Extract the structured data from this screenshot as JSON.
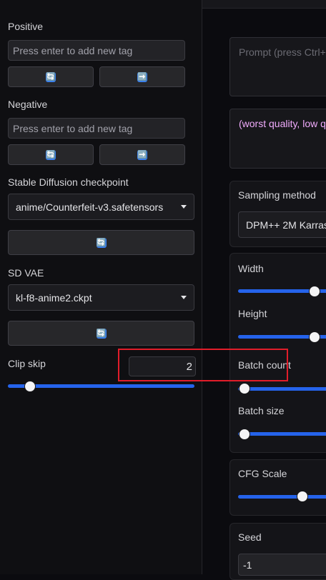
{
  "left": {
    "positive": {
      "label": "Positive",
      "placeholder": "Press enter to add new tag",
      "refresh_icon": "🔄",
      "send_icon": "➡️"
    },
    "negative": {
      "label": "Negative",
      "placeholder": "Press enter to add new tag",
      "refresh_icon": "🔄",
      "send_icon": "➡️"
    },
    "checkpoint": {
      "label": "Stable Diffusion checkpoint",
      "value": "anime/Counterfeit-v3.safetensors",
      "refresh_icon": "🔄"
    },
    "vae": {
      "label": "SD VAE",
      "value": "kl-f8-anime2.ckpt",
      "refresh_icon": "🔄"
    },
    "clip_skip": {
      "label": "Clip skip",
      "value": "2",
      "slider_fraction": 0.12
    }
  },
  "right": {
    "prompt_placeholder": "Prompt (press Ctrl+",
    "negative_prompt_text": "(worst quality, low q",
    "sampling": {
      "label": "Sampling method",
      "value": "DPM++ 2M Karras"
    },
    "width": {
      "label": "Width"
    },
    "height": {
      "label": "Height"
    },
    "batch_count": {
      "label": "Batch count"
    },
    "batch_size": {
      "label": "Batch size"
    },
    "cfg_scale": {
      "label": "CFG Scale"
    },
    "seed": {
      "label": "Seed",
      "value": "-1"
    }
  },
  "colors": {
    "accent": "#2563eb",
    "highlight": "#e11d2a",
    "negative_prompt": "#f0abfc"
  }
}
